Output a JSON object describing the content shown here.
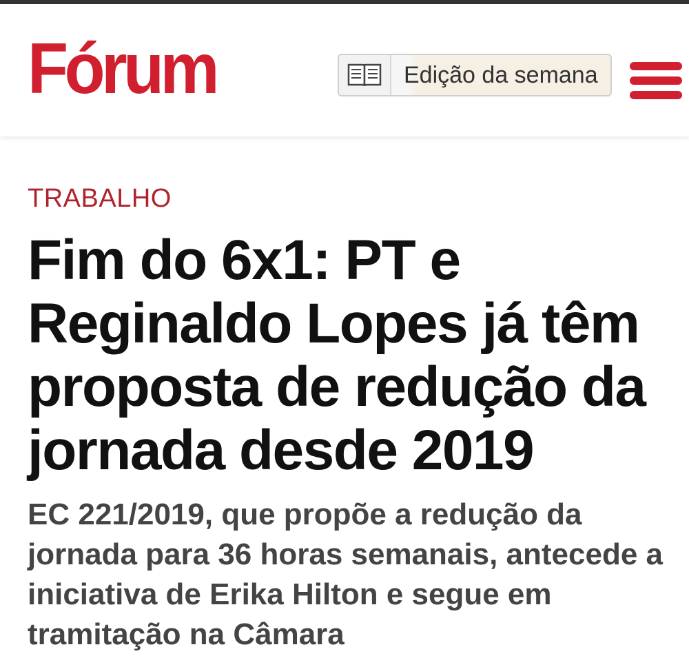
{
  "header": {
    "logo_text": "Fórum",
    "edition_button_label": "Edição da semana",
    "colors": {
      "brand": "#d11f2f",
      "category": "#b0222d"
    }
  },
  "article": {
    "category": "TRABALHO",
    "headline": "Fim do 6x1: PT e Reginaldo Lopes já têm proposta de redução da jornada desde 2019",
    "subtitle": "EC 221/2019, que propõe a redução da jornada para 36 horas semanais, antecede a iniciativa de Erika Hilton e segue em tramitação na Câmara"
  },
  "icons": {
    "edition": "open-book-icon",
    "menu": "hamburger-menu-icon"
  }
}
